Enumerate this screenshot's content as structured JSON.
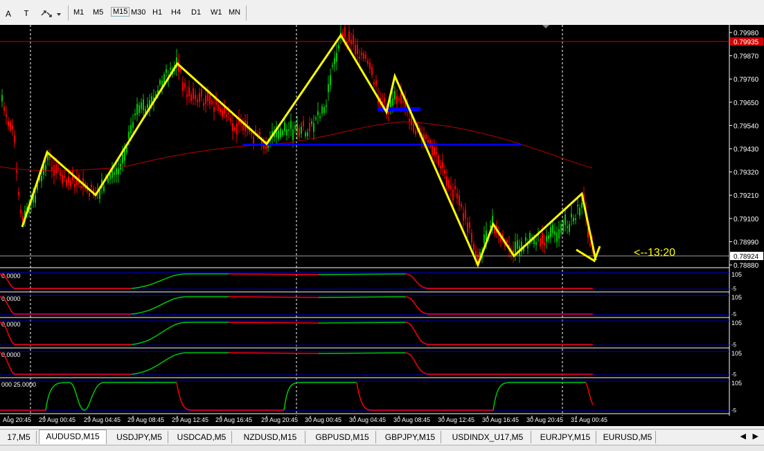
{
  "toolbar": {
    "text_tool": "A",
    "cursor_tool": "T",
    "timeframes": [
      "M1",
      "M5",
      "M15",
      "M30",
      "H1",
      "H4",
      "D1",
      "W1",
      "MN"
    ]
  },
  "price_axis": {
    "ticks": [
      "0.79980",
      "0.79870",
      "0.79760",
      "0.79650",
      "0.79540",
      "0.79430",
      "0.79320",
      "0.79210",
      "0.79100",
      "0.78990",
      "0.78880"
    ],
    "red_line_label": "0.79935",
    "current_label": "0.78924"
  },
  "countdown": "<--13:20",
  "indicators": [
    {
      "label": "0.0000",
      "scale_top": "105",
      "scale_bot": "-5"
    },
    {
      "label": "0.0000",
      "scale_top": "105",
      "scale_bot": "-5"
    },
    {
      "label": "0.0000",
      "scale_top": "105",
      "scale_bot": "-5"
    },
    {
      "label": "0.0000",
      "scale_top": "105",
      "scale_bot": "-5"
    },
    {
      "label": "000 25.0000",
      "scale_top": "105",
      "scale_bot": "-5"
    }
  ],
  "time_axis": [
    "Aug 20:45",
    "29 Aug 00:45",
    "29 Aug 04:45",
    "29 Aug 08:45",
    "29 Aug 12:45",
    "29 Aug 16:45",
    "29 Aug 20:45",
    "30 Aug 00:45",
    "30 Aug 04:45",
    "30 Aug 08:45",
    "30 Aug 12:45",
    "30 Aug 16:45",
    "30 Aug 20:45",
    "31 Aug 00:45"
  ],
  "tabs": [
    "17,M5",
    "AUDUSD,M15",
    "USDJPY,M5",
    "USDCAD,M5",
    "NZDUSD,M15",
    "GBPUSD,M15",
    "GBPJPY,M15",
    "USDINDX_U17,M5",
    "EURJPY,M15",
    "EURUSD,M5"
  ],
  "active_tab": 1,
  "colors": {
    "background": "#000000",
    "bull": "#00c800",
    "bear": "#ff0000",
    "zigzag": "#ffff00",
    "level": "#0000ff",
    "ma": "#c00000",
    "current_price_line": "#a0a0a0"
  }
}
